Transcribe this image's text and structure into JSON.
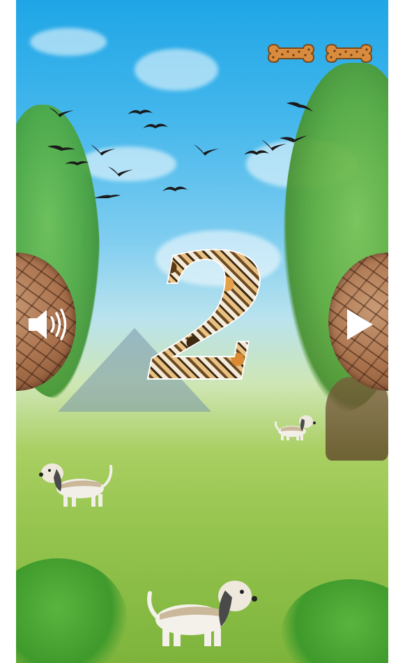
{
  "game": {
    "countdown": "2",
    "lives_remaining": 2
  },
  "icons": {
    "life": "bone-icon",
    "sound": "speaker-volume-icon",
    "play": "play-triangle-icon",
    "bird": "bird-silhouette",
    "dog": "basset-hound"
  },
  "colors": {
    "sky": "#3fb4ec",
    "grass": "#95c44e",
    "bone": "#d98c3e",
    "button_wood": "#a8714c",
    "countdown_fill": "#c9863b"
  }
}
